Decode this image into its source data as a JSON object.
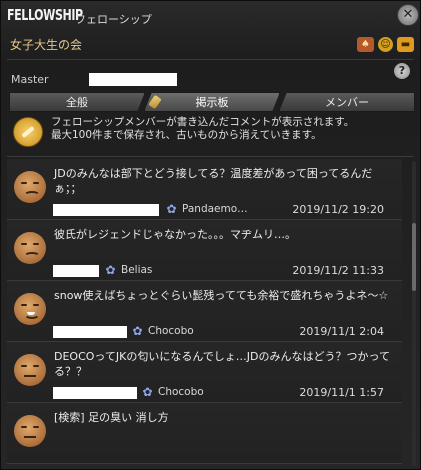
{
  "window": {
    "title_en": "FELLOWSHIP",
    "title_jp": "フェローシップ",
    "fellowship_name": "女子大生の会",
    "master_label": "Master",
    "help_label": "?",
    "settings_label": "✕"
  },
  "tabs": [
    {
      "label": "全般",
      "active": false
    },
    {
      "label": "掲示板",
      "active": true
    },
    {
      "label": "メンバー",
      "active": false
    }
  ],
  "notice": {
    "line1": "フェローシップメンバーが書き込んだコメントが表示されます。",
    "line2": "最大100件まで保存され、古いものから消えていきます。"
  },
  "posts": [
    {
      "text": "JDのみんなは部下とどう接してる？温度差があって困ってるんだぁ；；",
      "author": "Pandaemo…",
      "date": "2019/11/2 19:20",
      "avatar": "sad"
    },
    {
      "text": "彼氏がレジェンドじゃなかった。。。マヂムリ…。",
      "author": "Belias",
      "date": "2019/11/2 11:33",
      "avatar": "sad"
    },
    {
      "text": "snow使えばちょっとぐらい髭残ってても余裕で盛れちゃうよネ～☆",
      "author": "Chocobo",
      "date": "2019/11/1 2:04",
      "avatar": "smile"
    },
    {
      "text": "DEOCOってJKの匂いになるんでしょ…JDのみんなはどう？つかってる？？",
      "author": "Chocobo",
      "date": "2019/11/1 1:57",
      "avatar": "flat"
    },
    {
      "text": "[検索] 足の臭い 消し方",
      "author": "",
      "date": "",
      "avatar": "flat"
    }
  ]
}
